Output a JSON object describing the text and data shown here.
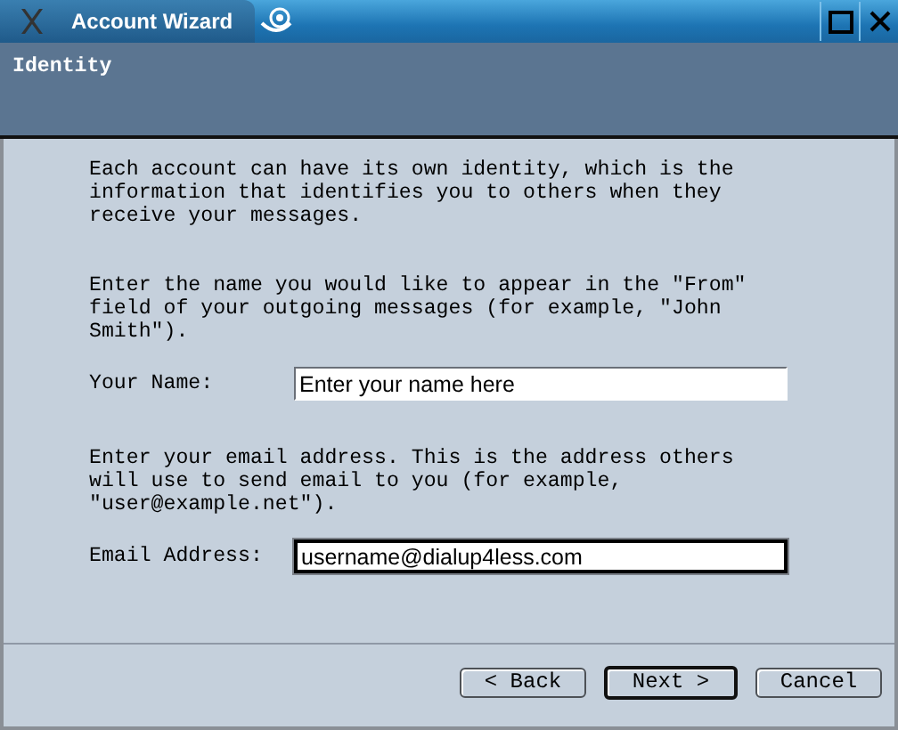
{
  "window": {
    "title": "Account Wizard"
  },
  "header": {
    "title": "Identity"
  },
  "intro": "Each account can have its own identity, which is the information that identifies you to others when they receive your messages.",
  "sections": [
    {
      "text": "Enter the name you would like to appear in the \"From\" field of your outgoing messages (for example, \"John Smith\").",
      "label": "Your Name:",
      "value": "Enter your name here",
      "focused": false
    },
    {
      "text": "Enter your email address. This is the address others will use to send email to you (for example, \"user@example.net\").",
      "label": "Email Address:",
      "value": "username@dialup4less.com",
      "focused": true
    }
  ],
  "buttons": [
    {
      "label": "< Back",
      "default": false
    },
    {
      "label": "Next >",
      "default": true
    },
    {
      "label": "Cancel",
      "default": false
    }
  ]
}
